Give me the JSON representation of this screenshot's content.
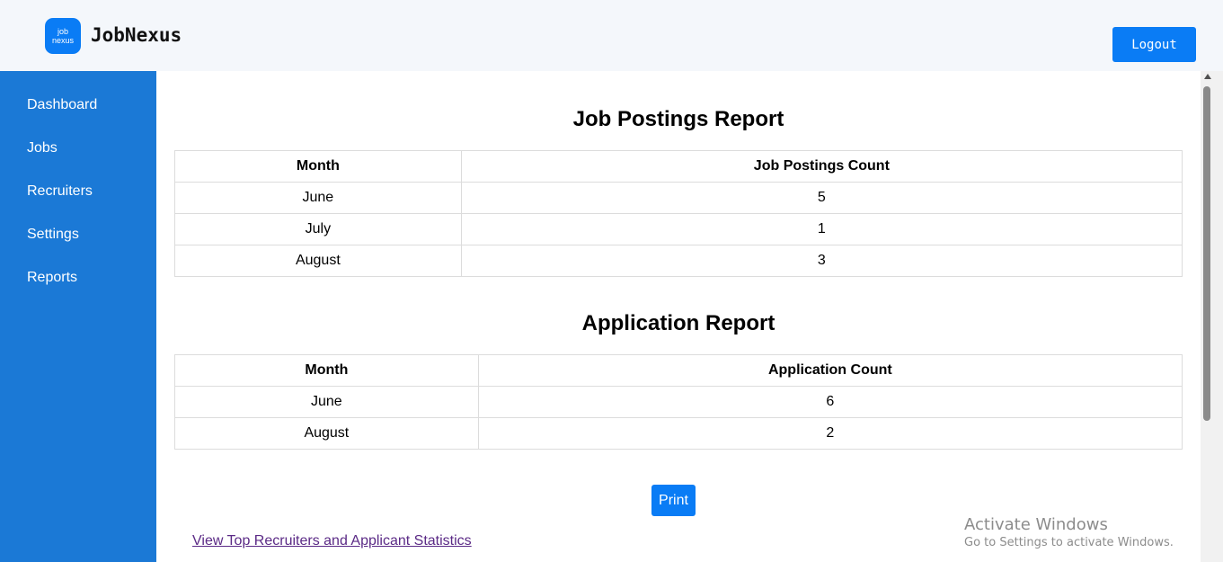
{
  "header": {
    "logo_line1": "job",
    "logo_line2": "nexus",
    "brand": "JobNexus",
    "logout_label": "Logout"
  },
  "sidebar": {
    "items": [
      {
        "label": "Dashboard"
      },
      {
        "label": "Jobs"
      },
      {
        "label": "Recruiters"
      },
      {
        "label": "Settings"
      },
      {
        "label": "Reports"
      }
    ]
  },
  "job_postings": {
    "title": "Job Postings Report",
    "headers": [
      "Month",
      "Job Postings Count"
    ],
    "rows": [
      [
        "June",
        "5"
      ],
      [
        "July",
        "1"
      ],
      [
        "August",
        "3"
      ]
    ]
  },
  "applications": {
    "title": "Application Report",
    "headers": [
      "Month",
      "Application Count"
    ],
    "rows": [
      [
        "June",
        "6"
      ],
      [
        "August",
        "2"
      ]
    ]
  },
  "print_label": "Print",
  "stats_link": "View Top Recruiters and Applicant Statistics",
  "watermark": {
    "title": "Activate Windows",
    "subtitle": "Go to Settings to activate Windows."
  },
  "colors": {
    "accent": "#0a7cf5",
    "sidebar": "#1b79d6",
    "header_bg": "#f4f7fb",
    "link": "#5b2a86"
  }
}
